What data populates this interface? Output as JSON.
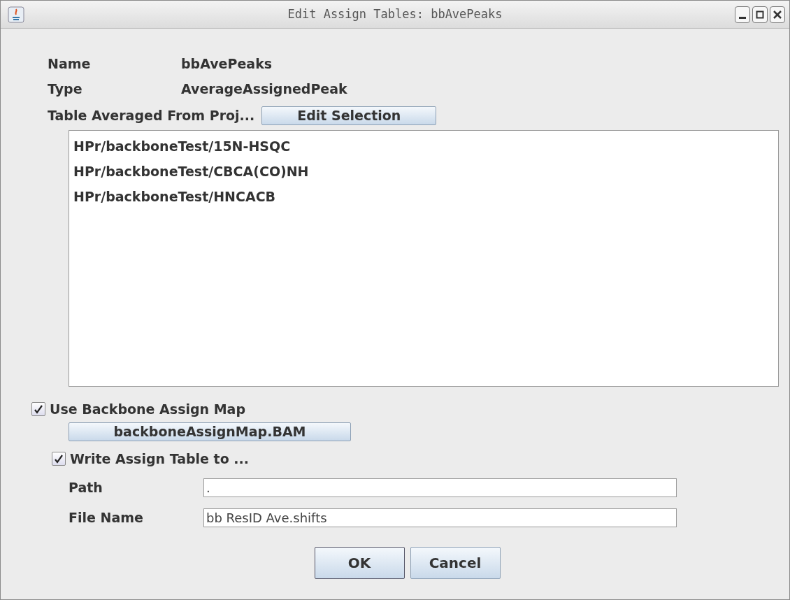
{
  "window": {
    "title": "Edit Assign Tables: bbAvePeaks"
  },
  "fields": [
    {
      "label": "Name",
      "value": "bbAvePeaks"
    },
    {
      "label": "Type",
      "value": "AverageAssignedPeak"
    }
  ],
  "source": {
    "label": "Table Averaged From Proj...",
    "button": "Edit Selection"
  },
  "source_tables": [
    "HPr/backboneTest/15N-HSQC",
    "HPr/backboneTest/CBCA(CO)NH",
    "HPr/backboneTest/HNCACB"
  ],
  "use_map": {
    "label": "Use Backbone Assign Map",
    "checked": true,
    "button": "backboneAssignMap.BAM"
  },
  "write_table": {
    "label": "Write Assign Table to ...",
    "checked": true
  },
  "output": [
    {
      "label": "Path",
      "value": "."
    },
    {
      "label": "File Name",
      "value": "bb ResID Ave.shifts"
    }
  ],
  "buttons": [
    "OK",
    "Cancel"
  ]
}
